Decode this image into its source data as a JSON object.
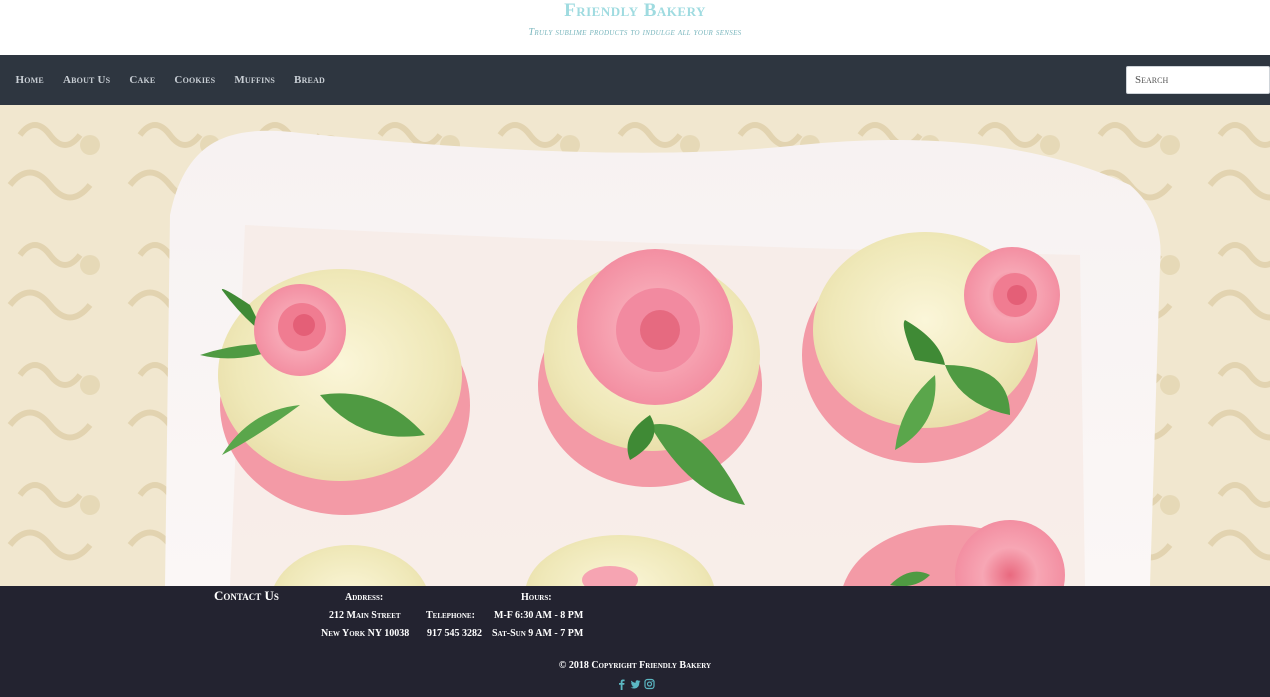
{
  "header": {
    "brand": "Friendly Bakery",
    "tagline": "Truly sublime products to indulge all your senses"
  },
  "nav": {
    "items": [
      {
        "label": "Home"
      },
      {
        "label": "About Us"
      },
      {
        "label": "Cake"
      },
      {
        "label": "Cookies"
      },
      {
        "label": "Muffins"
      },
      {
        "label": "Bread"
      }
    ],
    "search_placeholder": "Search"
  },
  "hero": {
    "subject": "cupcakes with pink sugar roses on a white platter"
  },
  "footer": {
    "contact_title": "Contact Us",
    "address_label": "Address:",
    "address_line1": "212 Main Street",
    "address_line2": "New York NY 10038",
    "telephone_label": "Telephone:",
    "telephone": "917 545 3282",
    "hours_label": "Hours:",
    "hours_line1": "M-F 6:30 AM - 8 PM",
    "hours_line2": "Sat-Sun 9 AM - 7 PM",
    "copyright": "© 2018 Copyright Friendly Bakery",
    "socials": [
      "facebook-icon",
      "twitter-icon",
      "instagram-icon"
    ]
  },
  "colors": {
    "brand": "#9fdbe0",
    "nav_bg": "#2e3640",
    "footer_bg": "#232330",
    "rose": "#f18fa2",
    "leaf": "#4f9a42"
  }
}
